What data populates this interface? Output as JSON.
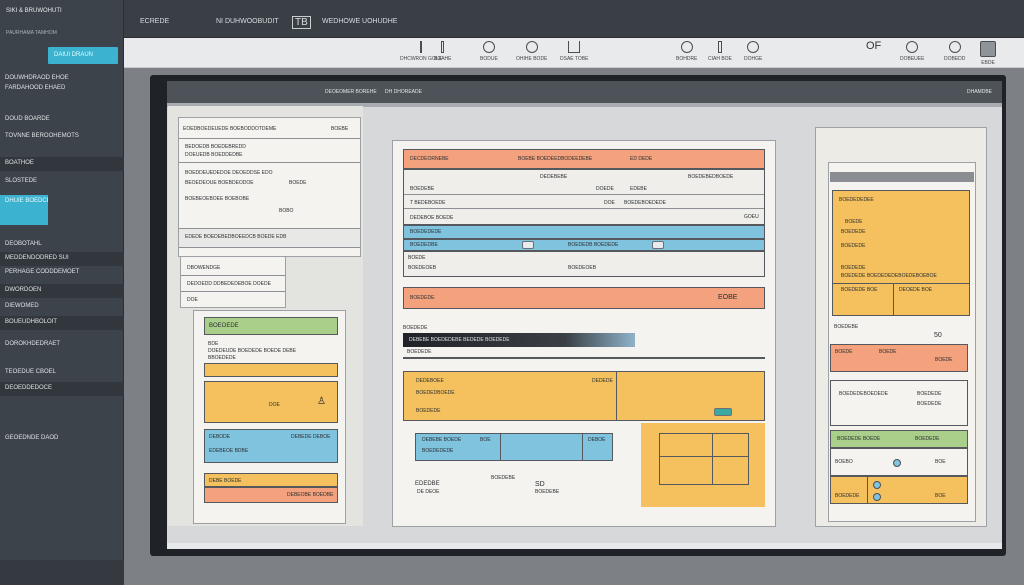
{
  "topbar": {
    "brand": "SIKI & BRUWOHUTI",
    "tab1": "ECREDE",
    "tab2": "NI DUHWOOBUDIT",
    "tab3": "WEDHOWE UOHUDHE",
    "badge": "TB"
  },
  "sidebar": {
    "brand": "SIKI & BRUWOHUTI",
    "sub": "PAURHAMA TAMHOM",
    "button": "DAIUI DRAUN",
    "items": [
      "DOUWHDRAOD EHOE",
      "FARDAHOOD EHAED",
      "DOUD BOARDE",
      "TOVNNE BEROOHEMOTS",
      "BOATHOE",
      "SLOSTEDE",
      "DHUIE BOEDCBE",
      "DEOBOTAHL",
      "MEDDENDODRED SUI",
      "PERHAGE CODDDEMOET",
      "DWORDOEN",
      "DIEWOMED",
      "BOUEUDHBOLOIT",
      "DOROKHDEDRAET",
      "TEOEDUE CBOEL",
      "DEOEDDEDOCE",
      "GEOEDNDE DAOD"
    ]
  },
  "toolbar": {
    "items": [
      {
        "icon": "dashboard-icon",
        "label": "DHCWRON GOLE"
      },
      {
        "icon": "bookmark-icon",
        "label": "BOAHE"
      },
      {
        "icon": "cloud-icon",
        "label": "BODUE"
      },
      {
        "icon": "settings-icon",
        "label": "OHIHE BODE"
      },
      {
        "icon": "user-icon",
        "label": "DSAE TOBE"
      },
      {
        "icon": "lock-icon",
        "label": "BOHDRE"
      },
      {
        "icon": "compass-icon",
        "label": "CIAH BOE"
      },
      {
        "icon": "globe-icon",
        "label": "DOHGE"
      },
      {
        "icon": "chart-icon",
        "label": "OF"
      },
      {
        "icon": "refresh-icon",
        "label": "DOBEUEE"
      },
      {
        "icon": "clock-icon",
        "label": "DOBEDD"
      },
      {
        "icon": "grid-icon",
        "label": "EBDE"
      }
    ]
  },
  "screen": {
    "header_left": "DEOEOMER BOREHE",
    "header_mid": "DH DHOREADE",
    "header_right": "DHAMDBE"
  },
  "left_doc": {
    "title": "EOEDBOEDEUEDE BOEBODDOTDEME",
    "corner": "BOEBE",
    "s1": "BEDOEDB BOEDEBREDD",
    "s2": "DOEUEDB BOEDDEDBE",
    "s3": "BOEDDEUEDEDOE DEOEDDSE EDO",
    "s4": "BEOEDEOUE BOEBDEODOE",
    "s4v": "BOEDE",
    "s5": "BOEBEOEBOEE BOEBOBE",
    "s5v": "BOBO",
    "bar": "EDEDE BOEDEBEDBOEEDCB BOEDE EDB",
    "s6": "DBOWENDGE",
    "s7": "DEDOEDD DDBEDEDEBOE DOEDE",
    "s8": "DOE"
  },
  "left_card": {
    "title": "BOEOEDE",
    "l1": "BDE",
    "l2": "DOEDEUDE BOEDEDE BOEDE DEBE",
    "l3": "BBOEDEDE",
    "amt": "DOE",
    "blue1": "DEBODE",
    "blue2": "DEBEDE DEBOE",
    "blue3": "EDEBEOE BDBE",
    "or1": "DEBE BOEDE",
    "or2": "DEBEOBE BOEDBE"
  },
  "center_doc": {
    "h1": "DECDEORNEBE",
    "h2": "BOEBE BOEDEEDBODEEDEBE",
    "h3": "ED DEDE",
    "r1a": "DEDEBEBE",
    "r1b": "BOEDEBE",
    "r1c": "DOEDE",
    "r1d": "EDEBE",
    "r2a": "T BEDEBOEDE",
    "r2b": "BOEDEBEDBOEDE",
    "r2c": "DOE",
    "r2d": "BOEDEBOEDEDE",
    "r3a": "DEDEBOE BOEDE",
    "r3b": "GOEU",
    "b1": "BOEDEDEDE",
    "b2": "BOEDEDBE",
    "b3": "BOEDEDB BOEDEDE",
    "b4": "BOEDE",
    "b5": "BOEDEOEB",
    "ob": "BOEDEDE",
    "ob2": "EOBE",
    "r4": "BOEDEDE",
    "dk": "DEBEBE BOEDEDEBE BEDEDE BOEDEDE",
    "dk2": "BOEDEDE",
    "y1": "DEDEBOEE",
    "y2": "DEDEDE",
    "y3": "BOEDEDBOEDE",
    "y4": "BOEDEDE",
    "t1": "DEBEBE BOEDE",
    "t2": "BOE",
    "t3": "DEBOE",
    "t4": "BOEDEDEDE",
    "f1": "EDEDBE",
    "f2": "BOEDEBE",
    "f3": "SD",
    "f4": "DE DEOE",
    "f5": "BOEDEBE"
  },
  "right_doc": {
    "yh": "BOEDEDEDEE",
    "y1": "BOEDE",
    "y2": "BOEDEDE",
    "y3": "BOEDEDE",
    "y4": "BOEDEDE",
    "y5": "BOEDEDE BOEDEDEDEBOEDEBOEBOE",
    "y6": "BOEDEDE BOE",
    "y7": "DEOEDE BOE",
    "g1": "BOEDEBE",
    "num": "50",
    "o1": "BOEDE",
    "o2": "BOEDE",
    "o3": "BOEDE",
    "w1": "BOEDEDEBOEDEDE",
    "w2": "BOEDEDE",
    "w3": "BOEDEDE",
    "gr1": "BOEDEDE BOEDE",
    "gr2": "BOEDEDE",
    "b1": "BOEBO",
    "b2": "BOE",
    "yy1": "BOEDEDE",
    "yy2": "BOE"
  }
}
